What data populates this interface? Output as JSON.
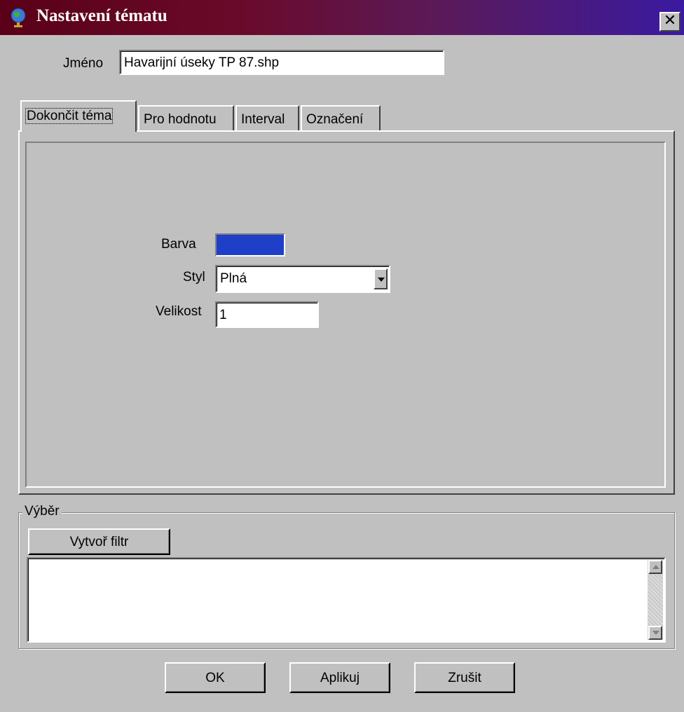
{
  "window": {
    "title": "Nastavení tématu",
    "title_icon": "globe-icon",
    "close_symbol": "✕"
  },
  "name_field": {
    "label": "Jméno",
    "value": "Havarijní úseky TP 87.shp"
  },
  "tabs": [
    {
      "label": "Dokončit téma",
      "active": true
    },
    {
      "label": "Pro hodnotu",
      "active": false
    },
    {
      "label": "Interval",
      "active": false
    },
    {
      "label": "Označení",
      "active": false
    }
  ],
  "symbol": {
    "color_label": "Barva",
    "color_value": "#1f3fc8",
    "style_label": "Styl",
    "style_value": "Plná",
    "size_label": "Velikost",
    "size_value": "1"
  },
  "selection": {
    "legend": "Výběr",
    "create_filter_label": "Vytvoř filtr",
    "filter_text": ""
  },
  "buttons": {
    "ok": "OK",
    "apply": "Aplikuj",
    "cancel": "Zrušit"
  },
  "colors": {
    "dialog_bg": "#c0c0c0",
    "title_gradient_start": "#5a0018",
    "title_gradient_end": "#3a1aa0"
  }
}
